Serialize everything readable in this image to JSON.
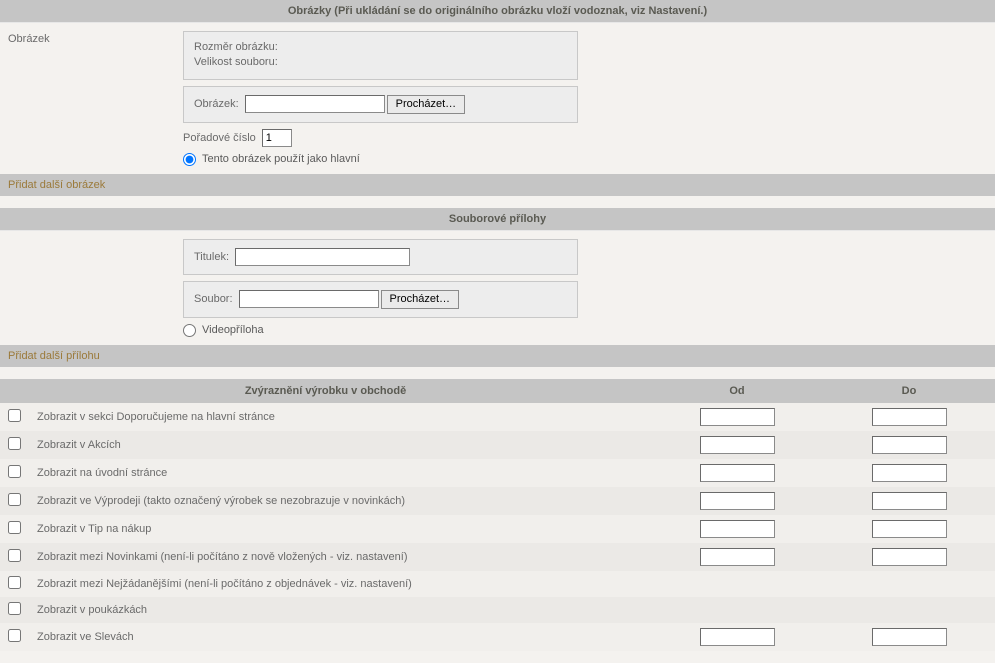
{
  "images": {
    "heading": "Obrázky (Při ukládání se do originálního obrázku vloží vodoznak, viz Nastavení.)",
    "label": "Obrázek",
    "dim_label": "Rozměr obrázku:",
    "size_label": "Velikost souboru:",
    "file_label": "Obrázek:",
    "browse": "Procházet…",
    "seq_label": "Pořadové číslo",
    "seq_value": "1",
    "main_radio": "Tento obrázek použít jako hlavní",
    "add_link": "Přidat další obrázek"
  },
  "attach": {
    "heading": "Souborové přílohy",
    "title_label": "Titulek:",
    "file_label": "Soubor:",
    "browse": "Procházet…",
    "video_radio": "Videopříloha",
    "add_link": "Přidat další přílohu"
  },
  "highlight": {
    "heading": "Zvýraznění výrobku v obchodě",
    "col_od": "Od",
    "col_do": "Do",
    "rows": [
      {
        "label": "Zobrazit v sekci Doporučujeme na hlavní stránce",
        "dates": true
      },
      {
        "label": "Zobrazit v Akcích",
        "dates": true
      },
      {
        "label": "Zobrazit na úvodní stránce",
        "dates": true
      },
      {
        "label": "Zobrazit ve Výprodeji (takto označený výrobek se nezobrazuje v novinkách)",
        "dates": true
      },
      {
        "label": "Zobrazit v Tip na nákup",
        "dates": true
      },
      {
        "label": "Zobrazit mezi Novinkami (není-li počítáno z nově vložených - viz. nastavení)",
        "dates": true
      },
      {
        "label": "Zobrazit mezi Nejžádanějšími (není-li počítáno z objednávek - viz. nastavení)",
        "dates": false
      },
      {
        "label": "Zobrazit v poukázkách",
        "dates": false
      },
      {
        "label": "Zobrazit ve Slevách",
        "dates": true
      }
    ]
  }
}
